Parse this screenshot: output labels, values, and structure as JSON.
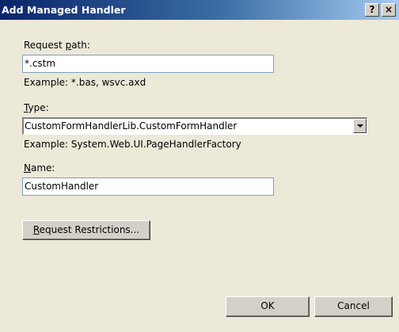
{
  "window": {
    "title": "Add Managed Handler",
    "help_label": "?",
    "close_label": "×"
  },
  "form": {
    "request_path": {
      "label_pre": "Request ",
      "label_key": "p",
      "label_post": "ath:",
      "value": "*.cstm",
      "example": "Example: *.bas, wsvc.axd"
    },
    "type": {
      "label_key": "T",
      "label_post": "ype:",
      "value": "CustomFormHandlerLib.CustomFormHandler",
      "example": "Example: System.Web.UI.PageHandlerFactory"
    },
    "name": {
      "label_key": "N",
      "label_post": "ame:",
      "value": "CustomHandler"
    },
    "restrictions_button": {
      "label_key": "R",
      "label_post": "equest Restrictions..."
    }
  },
  "footer": {
    "ok_label": "OK",
    "cancel_label": "Cancel"
  }
}
